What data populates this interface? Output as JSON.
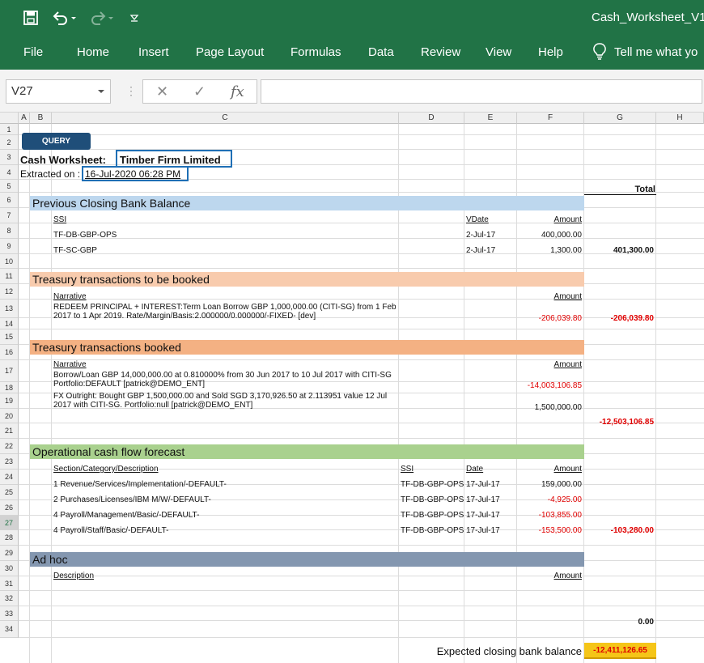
{
  "window": {
    "title": "Cash_Worksheet_V1"
  },
  "ribbon": {
    "tabs": [
      "File",
      "Home",
      "Insert",
      "Page Layout",
      "Formulas",
      "Data",
      "Review",
      "View",
      "Help"
    ],
    "tell_me": "Tell me what yo"
  },
  "formula_bar": {
    "name_box": "V27",
    "fx": "fx",
    "content": ""
  },
  "columns": [
    "A",
    "B",
    "C",
    "D",
    "E",
    "F",
    "G",
    "H"
  ],
  "rows": [
    "1",
    "2",
    "3",
    "4",
    "5",
    "6",
    "7",
    "8",
    "9",
    "10",
    "11",
    "12",
    "13",
    "14",
    "15",
    "16",
    "17",
    "18",
    "19",
    "20",
    "21",
    "22",
    "23",
    "24",
    "25",
    "26",
    "27",
    "28",
    "29",
    "30",
    "31",
    "32",
    "33",
    "34"
  ],
  "sheet": {
    "query_button": "QUERY",
    "title_label": "Cash Worksheet:",
    "company": "Timber Firm Limited",
    "extracted_label": "Extracted on :",
    "extracted_date": "16-Jul-2020 06:28 PM",
    "total_header": "Total",
    "prev": {
      "title": "Previous Closing Bank Balance",
      "h_ssi": "SSI",
      "h_vdate": "VDate",
      "h_amount": "Amount",
      "rows": [
        {
          "ssi": "TF-DB-GBP-OPS",
          "date": "2-Jul-17",
          "amount": "400,000.00"
        },
        {
          "ssi": "TF-SC-GBP",
          "date": "2-Jul-17",
          "amount": "1,300.00"
        }
      ],
      "total": "401,300.00"
    },
    "tobook": {
      "title": "Treasury transactions to be booked",
      "h_narrative": "Narrative",
      "h_amount": "Amount",
      "narrative": "REDEEM PRINCIPAL + INTEREST:Term Loan Borrow GBP 1,000,000.00 (CITI-SG) from 1 Feb 2017 to 1 Apr 2019. Rate/Margin/Basis:2.000000/0.000000/-FIXED- [dev]",
      "amount": "-206,039.80",
      "total": "-206,039.80"
    },
    "booked": {
      "title": "Treasury transactions booked",
      "h_narrative": "Narrative",
      "h_amount": "Amount",
      "rows": [
        {
          "narrative": "Borrow/Loan GBP 14,000,000.00 at 0.810000% from 30 Jun 2017 to 10 Jul 2017 with CITI-SG  Portfolio:DEFAULT [patrick@DEMO_ENT]",
          "amount": "-14,003,106.85"
        },
        {
          "narrative": "FX Outright: Bought GBP 1,500,000.00 and Sold SGD 3,170,926.50 at 2.113951 value 12 Jul 2017 with CITI-SG. Portfolio:null [patrick@DEMO_ENT]",
          "amount": "1,500,000.00"
        }
      ],
      "total": "-12,503,106.85"
    },
    "ops": {
      "title": "Operational cash flow forecast",
      "h_section": "Section/Category/Description",
      "h_ssi": "SSI",
      "h_date": "Date",
      "h_amount": "Amount",
      "rows": [
        {
          "desc": "1 Revenue/Services/Implementation/-DEFAULT-",
          "ssi": "TF-DB-GBP-OPS",
          "date": "17-Jul-17",
          "amount": "159,000.00"
        },
        {
          "desc": "2 Purchases/Licenses/IBM M/W/-DEFAULT-",
          "ssi": "TF-DB-GBP-OPS",
          "date": "17-Jul-17",
          "amount": "-4,925.00"
        },
        {
          "desc": "4 Payroll/Management/Basic/-DEFAULT-",
          "ssi": "TF-DB-GBP-OPS",
          "date": "17-Jul-17",
          "amount": "-103,855.00"
        },
        {
          "desc": "4 Payroll/Staff/Basic/-DEFAULT-",
          "ssi": "TF-DB-GBP-OPS",
          "date": "17-Jul-17",
          "amount": "-153,500.00"
        }
      ],
      "total": "-103,280.00"
    },
    "adhoc": {
      "title": "Ad hoc",
      "h_description": "Description",
      "h_amount": "Amount",
      "total": "0.00"
    },
    "closing": {
      "label": "Expected closing bank balance",
      "value": "-12,411,126.65"
    }
  },
  "colors": {
    "ribbon": "#217346",
    "prev_band": "#bdd7ee",
    "tobook_band": "#f8cbad",
    "booked_band": "#f4b183",
    "ops_band": "#a9d18e",
    "adhoc_band": "#8497b0",
    "negative": "#e00000",
    "total_fill": "#f5c518",
    "query_button": "#1f4e79",
    "highlight_box": "#1f6fb5"
  },
  "icons": [
    "save-icon",
    "undo-icon",
    "redo-icon",
    "customize-qat-icon",
    "lightbulb-icon",
    "cancel-icon",
    "enter-icon"
  ]
}
